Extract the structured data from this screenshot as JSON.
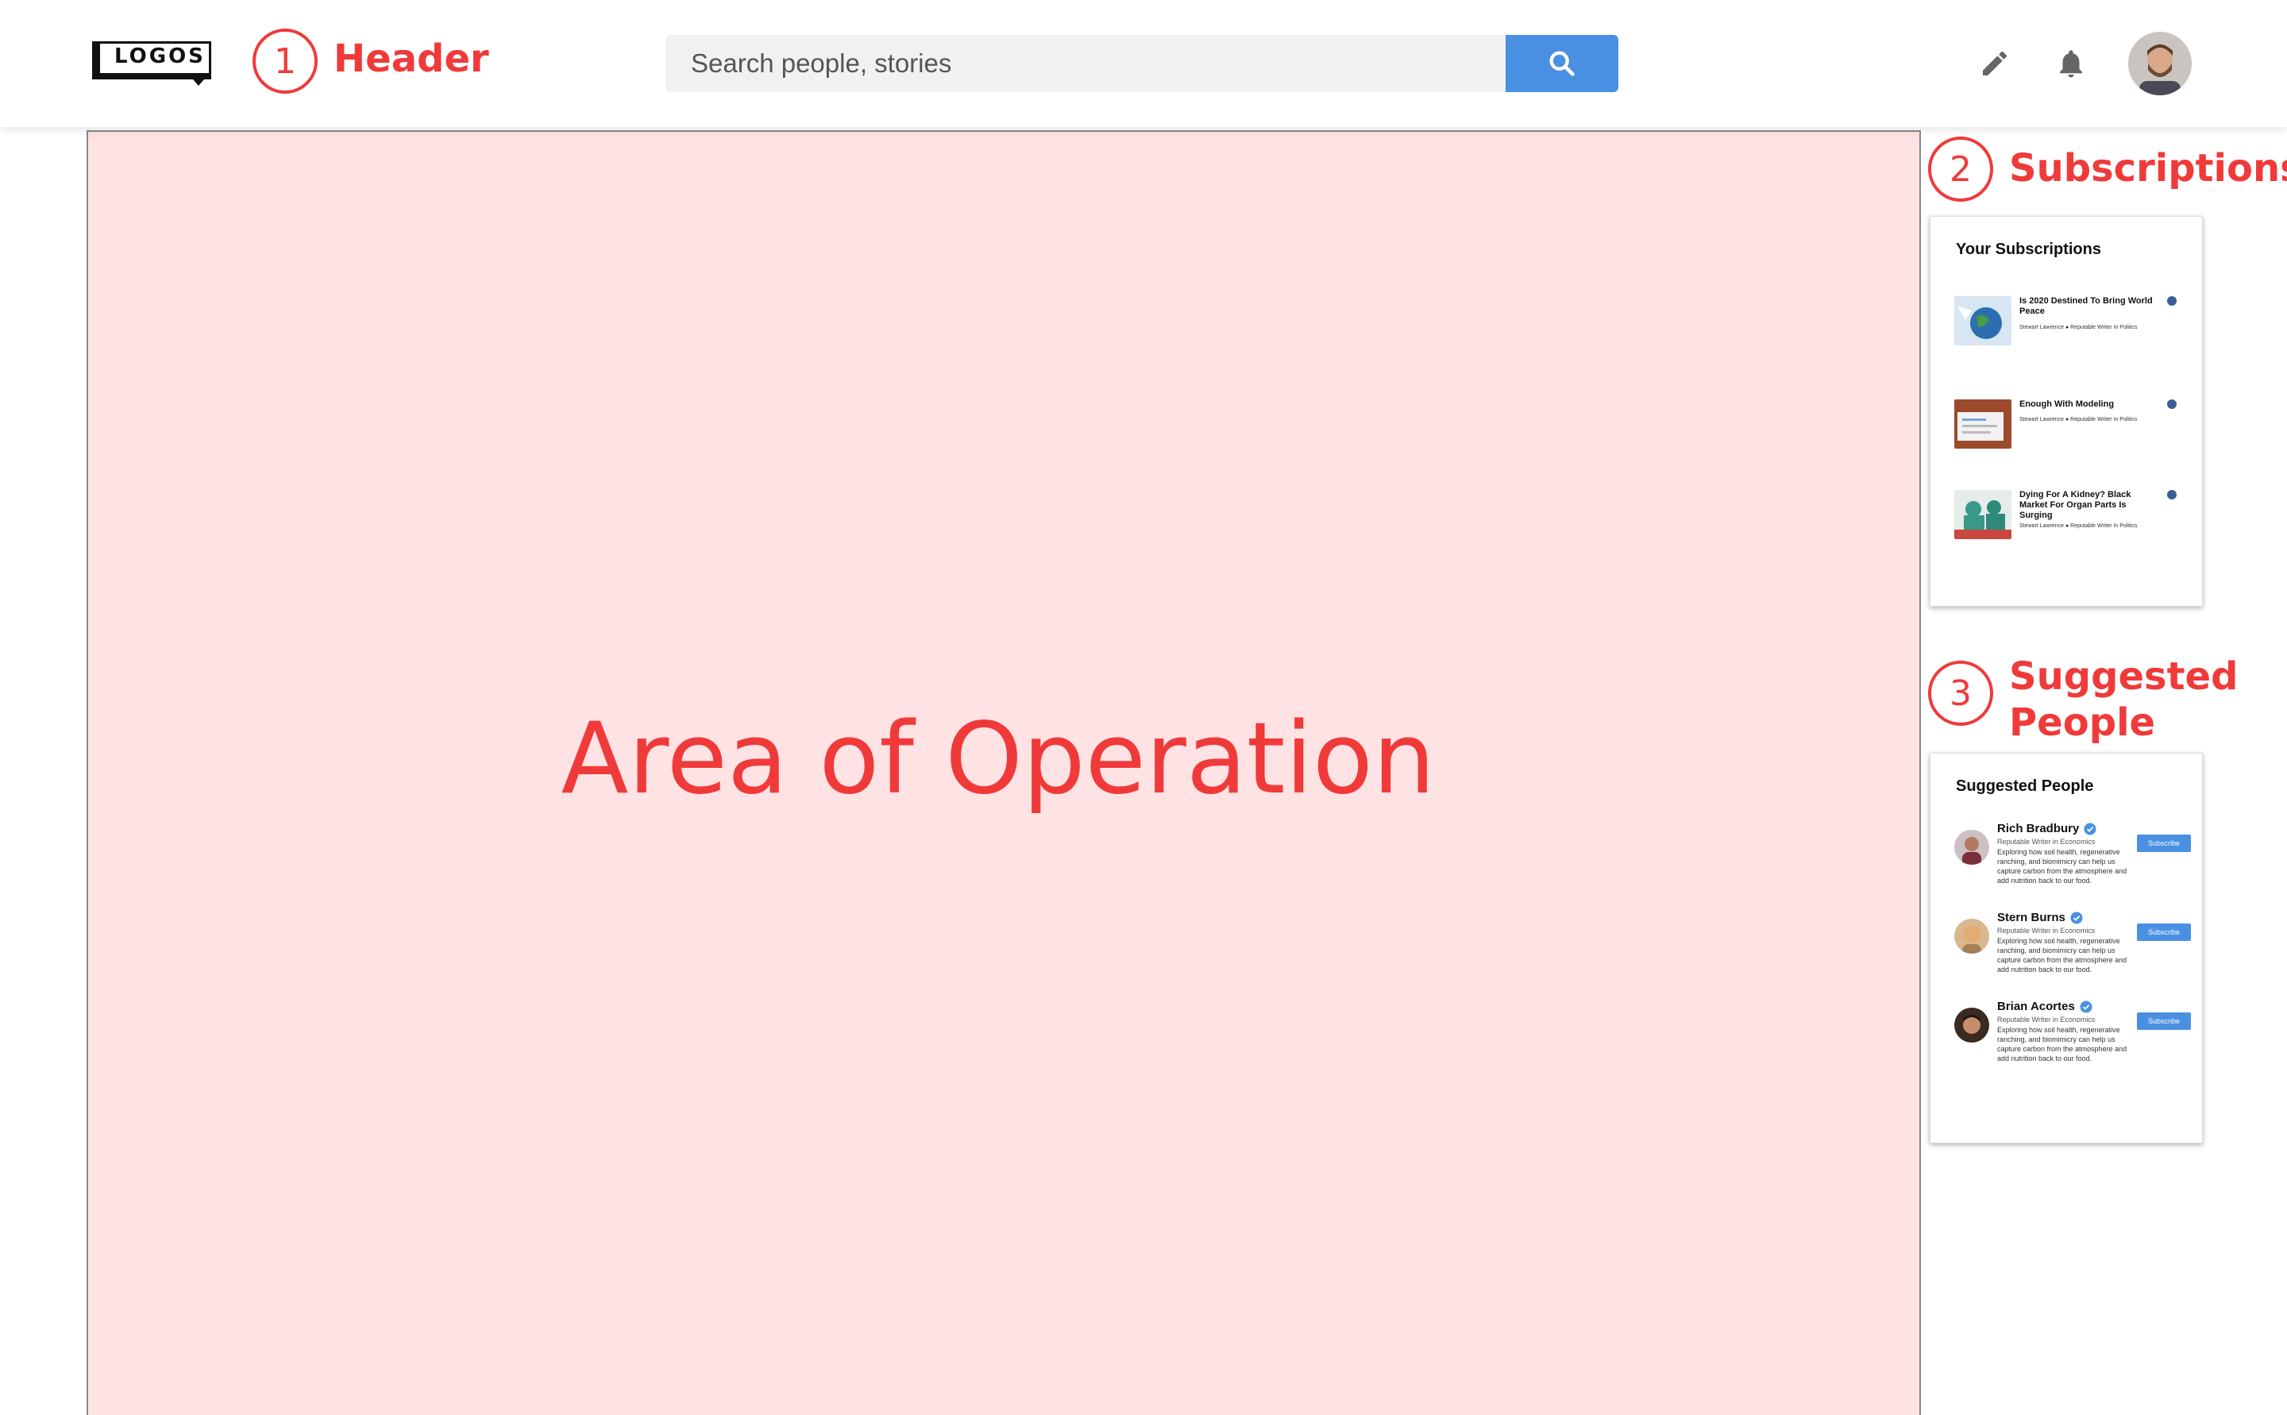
{
  "header": {
    "logo_text": "LOGOS",
    "annotation_number": "1",
    "annotation_label": "Header",
    "search_placeholder": "Search people, stories",
    "icons": {
      "search": "search-icon",
      "edit": "pencil-icon",
      "notifications": "bell-icon",
      "profile": "avatar"
    }
  },
  "main": {
    "area_label": "Area of Operation"
  },
  "subscriptions": {
    "annotation_number": "2",
    "annotation_label": "Subscriptions",
    "card_title": "Your Subscriptions",
    "items": [
      {
        "title": "Is 2020 Destined To Bring World Peace",
        "author": "Stewart Lawrence",
        "role": "Reputable Writer In Politics"
      },
      {
        "title": "Enough With Modeling",
        "author": "Stewart Lawrence",
        "role": "Reputable Writer In Politics"
      },
      {
        "title": "Dying For A Kidney? Black Market For Organ Parts Is Surging",
        "author": "Stewart Lawrence",
        "role": "Reputable Writer In Politics"
      }
    ]
  },
  "suggested": {
    "annotation_number": "3",
    "annotation_label_line1": "Suggested",
    "annotation_label_line2": "People",
    "card_title": "Suggested People",
    "subscribe_label": "Subscribe",
    "people": [
      {
        "name": "Rich Bradbury",
        "role": "Reputable Writer in Economics",
        "desc": "Exploring how soil health, regenerative ranching, and biomimicry can help us capture carbon from the atmosphere and add nutrition back to our food."
      },
      {
        "name": "Stern Burns",
        "role": "Reputable Writer in Economics",
        "desc": "Exploring how soil health, regenerative ranching, and biomimicry can help us capture carbon from the atmosphere and add nutrition back to our food."
      },
      {
        "name": "Brian Acortes",
        "role": "Reputable Writer in Economics",
        "desc": "Exploring how soil health, regenerative ranching, and biomimicry can help us capture carbon from the atmosphere and add nutrition back to our food."
      }
    ]
  },
  "colors": {
    "accent": "#4a90e2",
    "annotation": "#f03a3a",
    "area_bg": "#ffe2e3"
  }
}
